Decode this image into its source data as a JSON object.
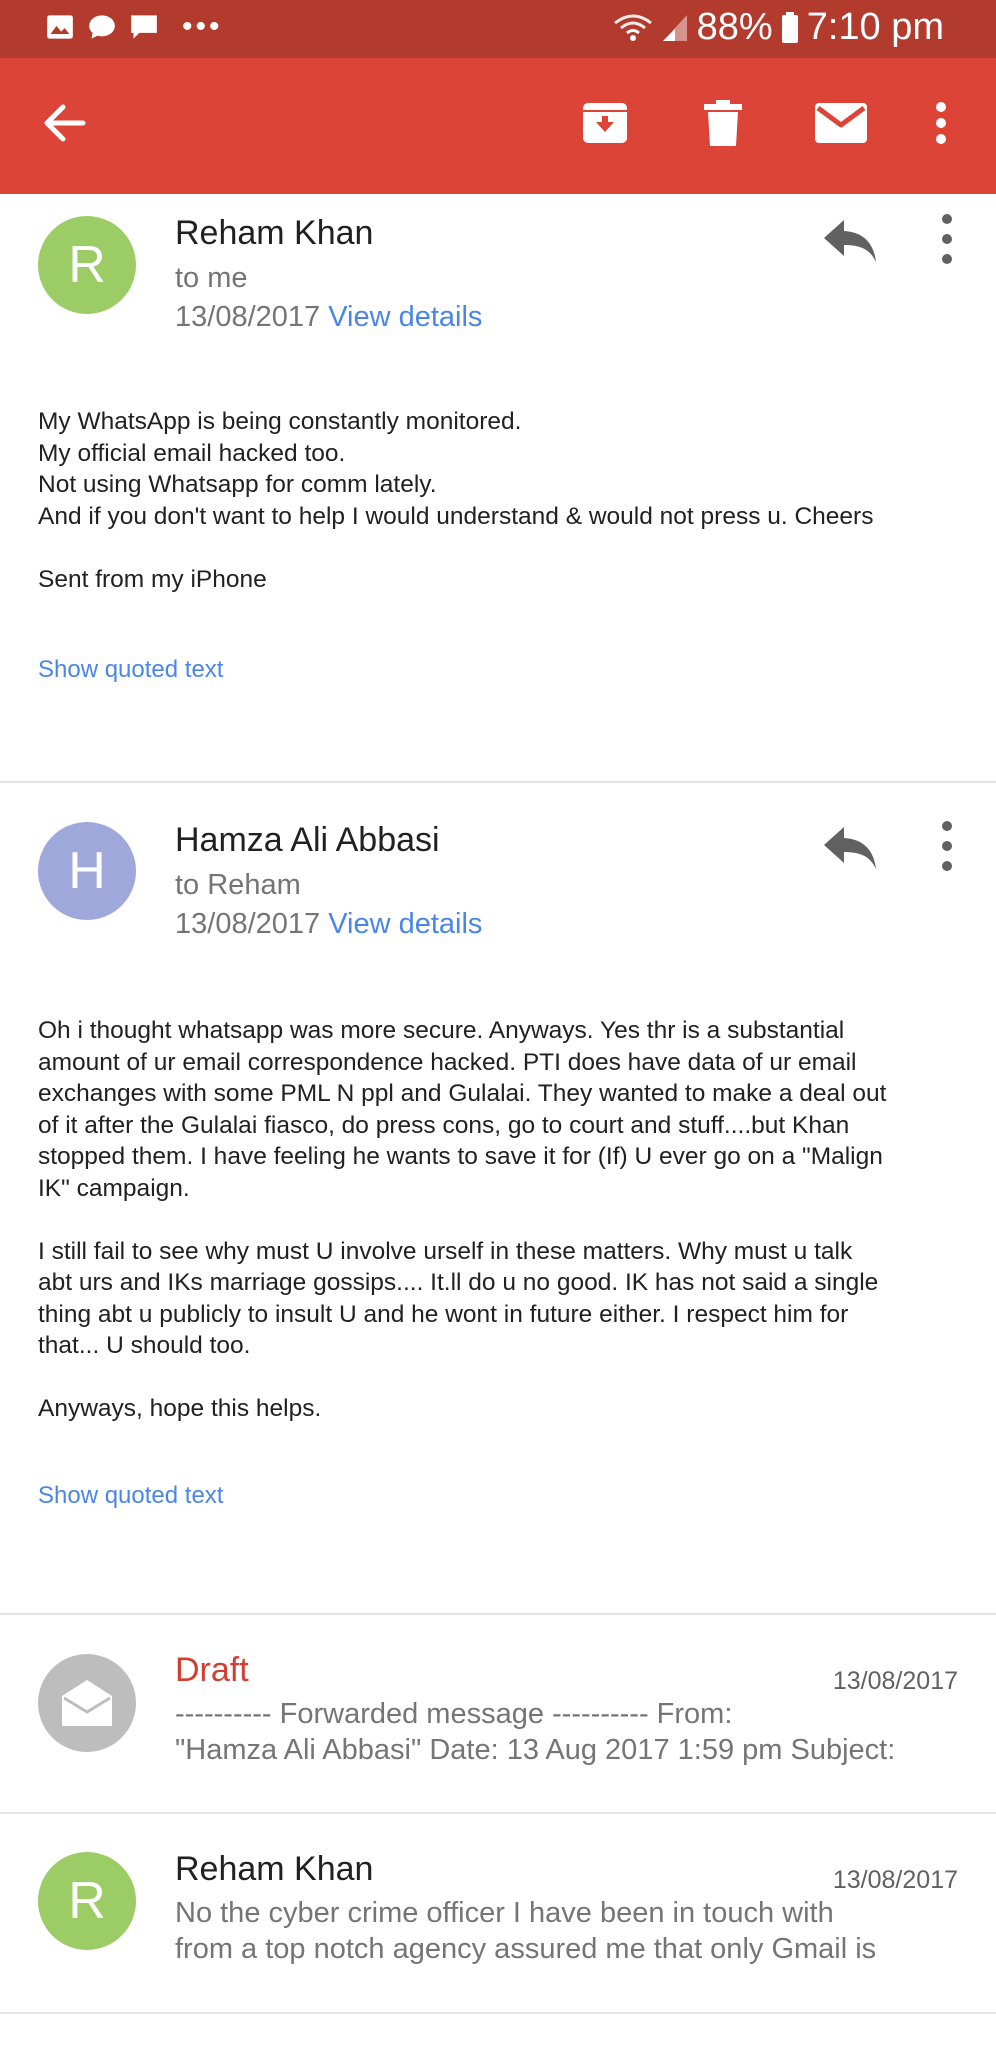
{
  "status_bar": {
    "battery": "88%",
    "time": "7:10 pm",
    "icons": [
      "image-icon",
      "chat-icon",
      "message-icon",
      "more-dots-icon",
      "wifi-icon",
      "signal-icon",
      "battery-icon"
    ]
  },
  "app_bar": {
    "icons": [
      "back-arrow-icon",
      "archive-icon",
      "delete-icon",
      "mark-unread-icon",
      "overflow-menu-icon"
    ]
  },
  "thread": [
    {
      "avatar_letter": "R",
      "avatar_color": "#9ccc65",
      "sender": "Reham Khan",
      "recipient": "to me",
      "date": "13/08/2017",
      "details_link": "View details",
      "body": "My WhatsApp is being constantly monitored.\nMy official email hacked too.\nNot using Whatsapp for comm lately.\nAnd if you don't want to help I would understand & would not press u. Cheers\n\nSent from my iPhone",
      "quoted_link": "Show quoted text"
    },
    {
      "avatar_letter": "H",
      "avatar_color": "#9fa8da",
      "sender": "Hamza Ali Abbasi",
      "recipient": "to Reham",
      "date": "13/08/2017",
      "details_link": "View details",
      "body": "Oh i thought whatsapp was more secure. Anyways. Yes thr is a substantial\namount of ur email correspondence hacked. PTI does have data of ur email\nexchanges with some PML N ppl and Gulalai. They wanted to make a deal out\nof it after the Gulalai fiasco, do press cons, go to court and stuff....but Khan\nstopped them. I have feeling he wants to save it for (If) U ever go on a \"Malign\nIK\" campaign.\n\nI still fail to see why must U involve urself in these matters. Why must u talk\nabt urs and IKs marriage gossips.... It.ll do u no good. IK has not said a single\nthing abt u publicly to insult U and he wont in future either. I respect him for\nthat... U should too.\n\nAnyways, hope this helps.",
      "quoted_link": "Show quoted text"
    }
  ],
  "collapsed": [
    {
      "label": "Draft",
      "label_color": "#d23f31",
      "avatar_color": "#bdbdbd",
      "date": "13/08/2017",
      "snippet_line1": "---------- Forwarded message ---------- From:",
      "snippet_line2": "\"Hamza Ali Abbasi\"  Date: 13 Aug 2017 1:59 pm Subject:"
    },
    {
      "label": "Reham Khan",
      "avatar_letter": "R",
      "avatar_color": "#9ccc65",
      "date": "13/08/2017",
      "snippet_line1": "No the cyber crime officer I have been in touch with",
      "snippet_line2": "from a top notch agency assured me that only Gmail is"
    }
  ]
}
